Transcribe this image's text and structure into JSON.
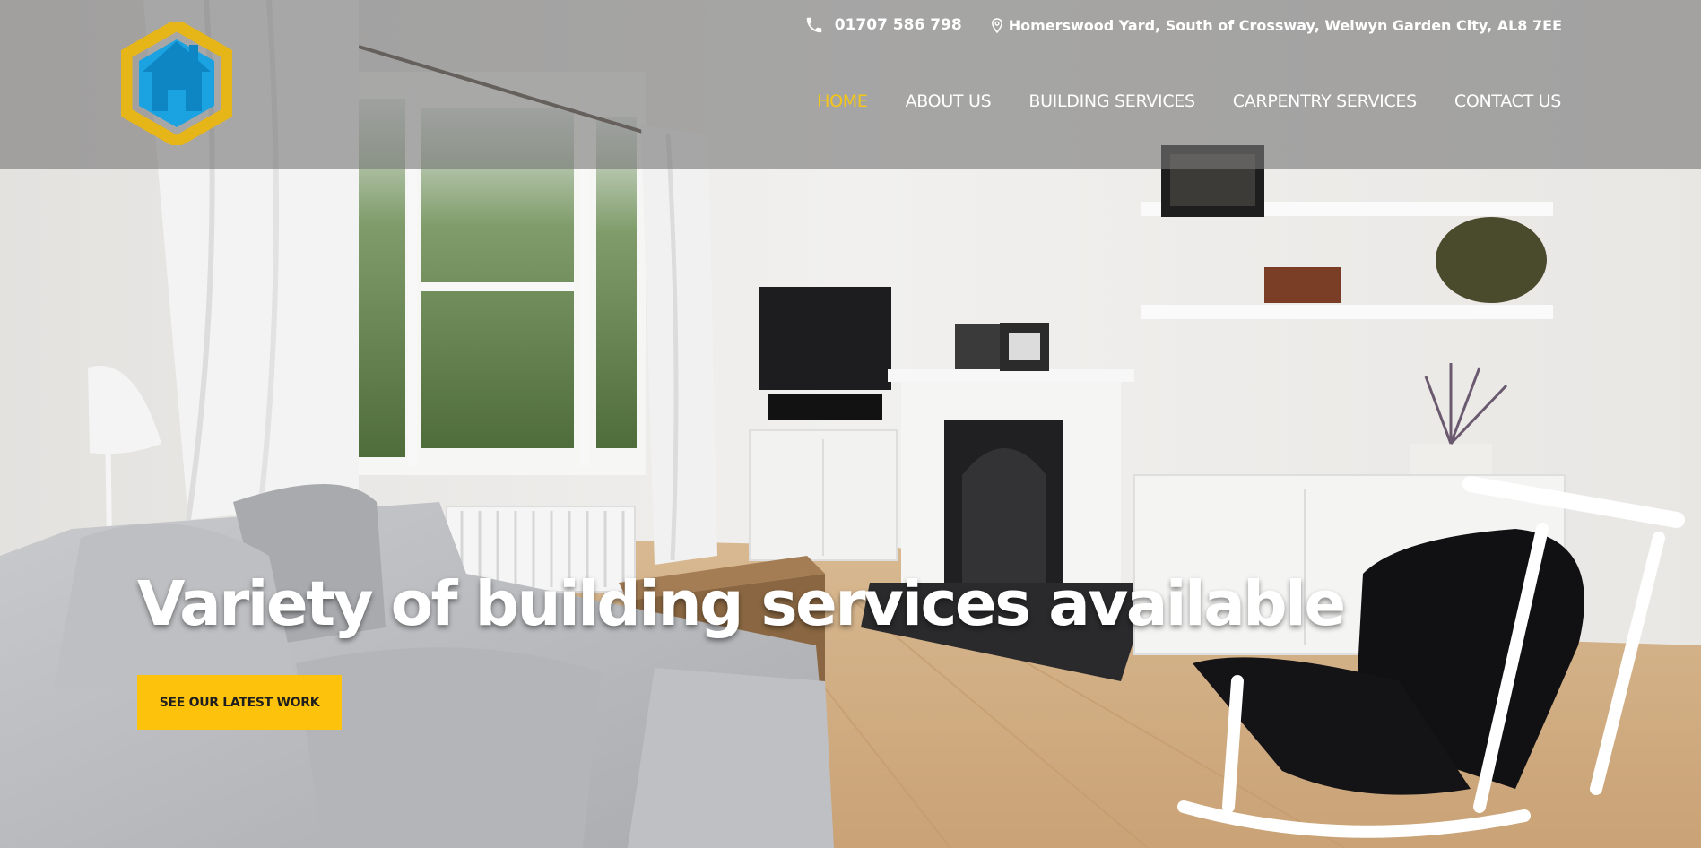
{
  "header": {
    "logo_name": "house-hexagon-logo",
    "phone": "01707 586 798",
    "address": "Homerswood Yard, South of Crossway, Welwyn Garden City, AL8 7EE"
  },
  "nav": {
    "items": [
      {
        "label": "HOME",
        "active": true
      },
      {
        "label": "ABOUT US",
        "active": false
      },
      {
        "label": "BUILDING SERVICES",
        "active": false
      },
      {
        "label": "CARPENTRY SERVICES",
        "active": false
      },
      {
        "label": "CONTACT US",
        "active": false
      }
    ]
  },
  "hero": {
    "headline": "Variety of building services available",
    "cta_label": "SEE OUR LATEST WORK"
  },
  "colors": {
    "accent": "#fcc20c",
    "active_nav": "#f5c518",
    "header_overlay": "#787878",
    "logo_blue": "#1aa3e0",
    "logo_gold": "#e8b619"
  }
}
